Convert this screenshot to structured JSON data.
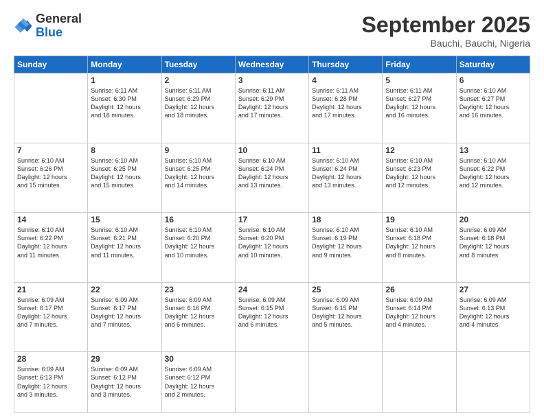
{
  "logo": {
    "general": "General",
    "blue": "Blue"
  },
  "title": "September 2025",
  "subtitle": "Bauchi, Bauchi, Nigeria",
  "weekdays": [
    "Sunday",
    "Monday",
    "Tuesday",
    "Wednesday",
    "Thursday",
    "Friday",
    "Saturday"
  ],
  "weeks": [
    [
      {
        "day": null
      },
      {
        "day": "1",
        "info": "Sunrise: 6:11 AM\nSunset: 6:30 PM\nDaylight: 12 hours\nand 18 minutes."
      },
      {
        "day": "2",
        "info": "Sunrise: 6:11 AM\nSunset: 6:29 PM\nDaylight: 12 hours\nand 18 minutes."
      },
      {
        "day": "3",
        "info": "Sunrise: 6:11 AM\nSunset: 6:29 PM\nDaylight: 12 hours\nand 17 minutes."
      },
      {
        "day": "4",
        "info": "Sunrise: 6:11 AM\nSunset: 6:28 PM\nDaylight: 12 hours\nand 17 minutes."
      },
      {
        "day": "5",
        "info": "Sunrise: 6:11 AM\nSunset: 6:27 PM\nDaylight: 12 hours\nand 16 minutes."
      },
      {
        "day": "6",
        "info": "Sunrise: 6:10 AM\nSunset: 6:27 PM\nDaylight: 12 hours\nand 16 minutes."
      }
    ],
    [
      {
        "day": "7",
        "info": "Sunrise: 6:10 AM\nSunset: 6:26 PM\nDaylight: 12 hours\nand 15 minutes."
      },
      {
        "day": "8",
        "info": "Sunrise: 6:10 AM\nSunset: 6:25 PM\nDaylight: 12 hours\nand 15 minutes."
      },
      {
        "day": "9",
        "info": "Sunrise: 6:10 AM\nSunset: 6:25 PM\nDaylight: 12 hours\nand 14 minutes."
      },
      {
        "day": "10",
        "info": "Sunrise: 6:10 AM\nSunset: 6:24 PM\nDaylight: 12 hours\nand 13 minutes."
      },
      {
        "day": "11",
        "info": "Sunrise: 6:10 AM\nSunset: 6:24 PM\nDaylight: 12 hours\nand 13 minutes."
      },
      {
        "day": "12",
        "info": "Sunrise: 6:10 AM\nSunset: 6:23 PM\nDaylight: 12 hours\nand 12 minutes."
      },
      {
        "day": "13",
        "info": "Sunrise: 6:10 AM\nSunset: 6:22 PM\nDaylight: 12 hours\nand 12 minutes."
      }
    ],
    [
      {
        "day": "14",
        "info": "Sunrise: 6:10 AM\nSunset: 6:22 PM\nDaylight: 12 hours\nand 11 minutes."
      },
      {
        "day": "15",
        "info": "Sunrise: 6:10 AM\nSunset: 6:21 PM\nDaylight: 12 hours\nand 11 minutes."
      },
      {
        "day": "16",
        "info": "Sunrise: 6:10 AM\nSunset: 6:20 PM\nDaylight: 12 hours\nand 10 minutes."
      },
      {
        "day": "17",
        "info": "Sunrise: 6:10 AM\nSunset: 6:20 PM\nDaylight: 12 hours\nand 10 minutes."
      },
      {
        "day": "18",
        "info": "Sunrise: 6:10 AM\nSunset: 6:19 PM\nDaylight: 12 hours\nand 9 minutes."
      },
      {
        "day": "19",
        "info": "Sunrise: 6:10 AM\nSunset: 6:18 PM\nDaylight: 12 hours\nand 8 minutes."
      },
      {
        "day": "20",
        "info": "Sunrise: 6:09 AM\nSunset: 6:18 PM\nDaylight: 12 hours\nand 8 minutes."
      }
    ],
    [
      {
        "day": "21",
        "info": "Sunrise: 6:09 AM\nSunset: 6:17 PM\nDaylight: 12 hours\nand 7 minutes."
      },
      {
        "day": "22",
        "info": "Sunrise: 6:09 AM\nSunset: 6:17 PM\nDaylight: 12 hours\nand 7 minutes."
      },
      {
        "day": "23",
        "info": "Sunrise: 6:09 AM\nSunset: 6:16 PM\nDaylight: 12 hours\nand 6 minutes."
      },
      {
        "day": "24",
        "info": "Sunrise: 6:09 AM\nSunset: 6:15 PM\nDaylight: 12 hours\nand 6 minutes."
      },
      {
        "day": "25",
        "info": "Sunrise: 6:09 AM\nSunset: 6:15 PM\nDaylight: 12 hours\nand 5 minutes."
      },
      {
        "day": "26",
        "info": "Sunrise: 6:09 AM\nSunset: 6:14 PM\nDaylight: 12 hours\nand 4 minutes."
      },
      {
        "day": "27",
        "info": "Sunrise: 6:09 AM\nSunset: 6:13 PM\nDaylight: 12 hours\nand 4 minutes."
      }
    ],
    [
      {
        "day": "28",
        "info": "Sunrise: 6:09 AM\nSunset: 6:13 PM\nDaylight: 12 hours\nand 3 minutes."
      },
      {
        "day": "29",
        "info": "Sunrise: 6:09 AM\nSunset: 6:12 PM\nDaylight: 12 hours\nand 3 minutes."
      },
      {
        "day": "30",
        "info": "Sunrise: 6:09 AM\nSunset: 6:12 PM\nDaylight: 12 hours\nand 2 minutes."
      },
      {
        "day": null
      },
      {
        "day": null
      },
      {
        "day": null
      },
      {
        "day": null
      }
    ]
  ]
}
